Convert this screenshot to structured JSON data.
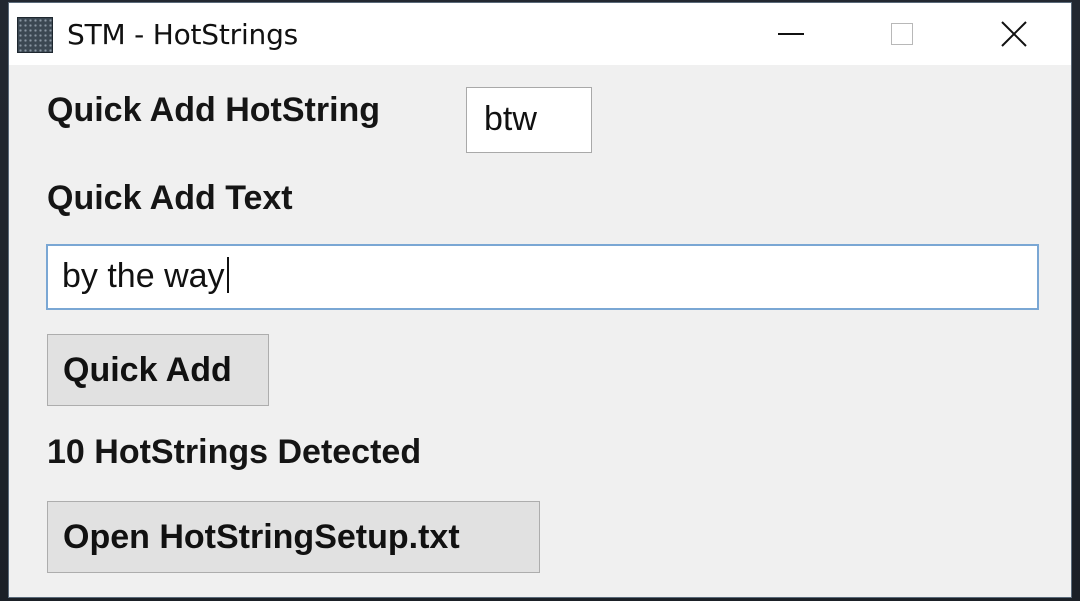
{
  "window": {
    "title": "STM - HotStrings",
    "icon": "app-icon"
  },
  "titlebar_buttons": {
    "minimize_icon": "minimize-icon",
    "maximize_icon": "maximize-icon",
    "close_icon": "close-icon"
  },
  "form": {
    "hotstring_label": "Quick Add HotString",
    "hotstring_value": "btw",
    "text_label": "Quick Add Text",
    "text_value": "by the way",
    "quick_add_label": "Quick Add",
    "detected_status": "10 HotStrings Detected",
    "open_setup_label": "Open HotStringSetup.txt"
  },
  "colors": {
    "window_bg": "#f0f0f0",
    "titlebar_bg": "#ffffff",
    "focus_border": "#7aa7d4",
    "button_bg": "#e1e1e1"
  }
}
